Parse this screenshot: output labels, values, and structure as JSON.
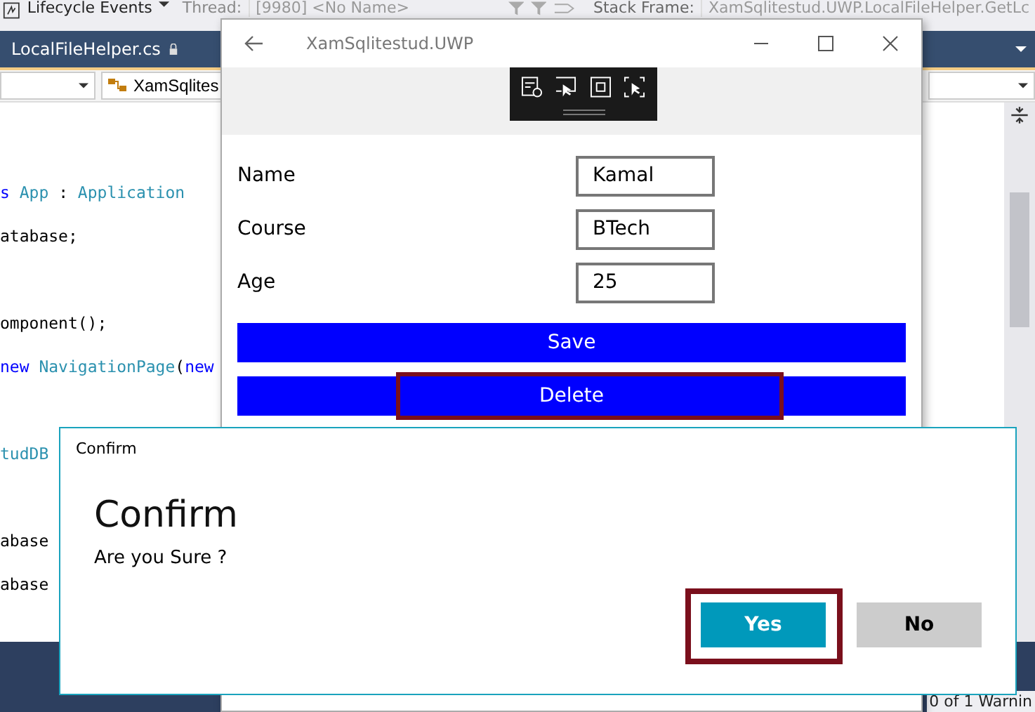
{
  "ide": {
    "toolbar": {
      "event_label": "Lifecycle Events",
      "thread_label": "Thread:",
      "thread_value": "[9980] <No Name>",
      "stack_label": "Stack Frame:",
      "stack_value": "XamSqlitestud.UWP.LocalFileHelper.GetLc"
    },
    "tab": {
      "label": "LocalFileHelper.cs",
      "pinned": true
    },
    "nav_dropdown": "XamSqlites",
    "code_lines": [
      {
        "tokens": [
          {
            "text": "s",
            "kind": "keyword"
          },
          {
            "text": " App",
            "kind": "type"
          },
          {
            "text": " : ",
            "kind": "plain"
          },
          {
            "text": "Application",
            "kind": "type"
          }
        ]
      },
      {
        "tokens": [
          {
            "text": "atabase;",
            "kind": "plain"
          }
        ]
      },
      {
        "blank_before": true,
        "tokens": [
          {
            "text": "omponent();",
            "kind": "plain"
          }
        ]
      },
      {
        "tokens": [
          {
            "text": "new",
            "kind": "keyword"
          },
          {
            "text": " NavigationPage",
            "kind": "type"
          },
          {
            "text": "(",
            "kind": "plain"
          },
          {
            "text": "new",
            "kind": "keyword"
          }
        ]
      },
      {
        "blank_before": true,
        "tokens": [
          {
            "text": "tudDB",
            "kind": "type"
          }
        ]
      },
      {
        "blank_before": true,
        "tokens": [
          {
            "text": "abase",
            "kind": "plain"
          }
        ]
      },
      {
        "tokens": [
          {
            "text": "abase",
            "kind": "plain"
          }
        ]
      }
    ],
    "status": "0 of 1 Warnin"
  },
  "app": {
    "title": "XamSqlitestud.UWP",
    "fields": [
      {
        "label": "Name",
        "value": "Kamal"
      },
      {
        "label": "Course",
        "value": "BTech"
      },
      {
        "label": "Age",
        "value": "25"
      }
    ],
    "buttons": [
      {
        "label": "Save",
        "highlighted": false
      },
      {
        "label": "Delete",
        "highlighted": true
      }
    ]
  },
  "dialog": {
    "title": "Confirm",
    "heading": "Confirm",
    "message": "Are you Sure ?",
    "buttons": [
      {
        "label": "Yes",
        "kind": "primary",
        "highlighted": true
      },
      {
        "label": "No",
        "kind": "secondary",
        "highlighted": false
      }
    ]
  }
}
